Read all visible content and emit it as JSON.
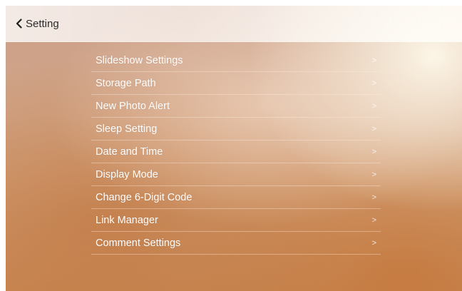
{
  "header": {
    "title": "Setting"
  },
  "menu": {
    "items": [
      {
        "label": "Slideshow Settings",
        "chevron": ">"
      },
      {
        "label": "Storage Path",
        "chevron": ">"
      },
      {
        "label": "New Photo Alert",
        "chevron": ">"
      },
      {
        "label": "Sleep Setting",
        "chevron": ">"
      },
      {
        "label": "Date and Time",
        "chevron": ">"
      },
      {
        "label": "Display Mode",
        "chevron": ">"
      },
      {
        "label": "Change 6-Digit Code",
        "chevron": ">"
      },
      {
        "label": "Link Manager",
        "chevron": ">"
      },
      {
        "label": "Comment Settings",
        "chevron": ">"
      }
    ]
  },
  "icons": {
    "back": "chevron-left-icon",
    "row_arrow": "chevron-right-icon"
  },
  "colors": {
    "header_background": "#ffffff",
    "menu_text": "#ffffff",
    "title_text": "#2a2a2a",
    "background_warm": "#c98a56"
  }
}
